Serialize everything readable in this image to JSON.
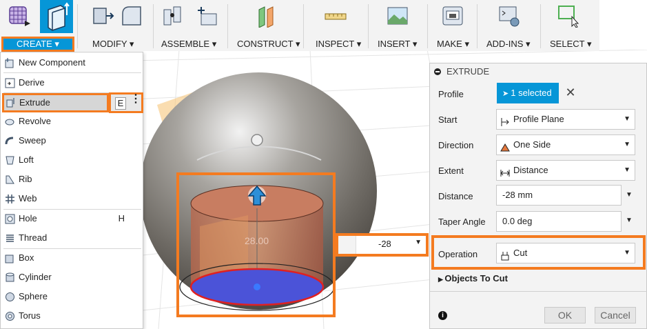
{
  "toolbar": {
    "groups": [
      {
        "label": "CREATE ▾"
      },
      {
        "label": "MODIFY ▾"
      },
      {
        "label": "ASSEMBLE ▾"
      },
      {
        "label": "CONSTRUCT ▾"
      },
      {
        "label": "INSPECT ▾"
      },
      {
        "label": "INSERT ▾"
      },
      {
        "label": "MAKE ▾"
      },
      {
        "label": "ADD-INS ▾"
      },
      {
        "label": "SELECT ▾"
      }
    ]
  },
  "create_menu": {
    "items": [
      {
        "label": "New Component",
        "icon": "new-component-icon"
      },
      {
        "label": "Derive",
        "icon": "derive-icon"
      },
      {
        "label": "Extrude",
        "icon": "extrude-icon",
        "shortcut": "E"
      },
      {
        "label": "Revolve",
        "icon": "revolve-icon"
      },
      {
        "label": "Sweep",
        "icon": "sweep-icon"
      },
      {
        "label": "Loft",
        "icon": "loft-icon"
      },
      {
        "label": "Rib",
        "icon": "rib-icon"
      },
      {
        "label": "Web",
        "icon": "web-icon"
      },
      {
        "label": "Hole",
        "icon": "hole-icon",
        "shortcut": "H"
      },
      {
        "label": "Thread",
        "icon": "thread-icon"
      },
      {
        "label": "Box",
        "icon": "box-icon"
      },
      {
        "label": "Cylinder",
        "icon": "cylinder-icon"
      },
      {
        "label": "Sphere",
        "icon": "sphere-icon"
      },
      {
        "label": "Torus",
        "icon": "torus-icon"
      }
    ]
  },
  "viewport": {
    "dimension_label": "28.00",
    "distance_input_value": "-28"
  },
  "extrude_panel": {
    "title": "EXTRUDE",
    "rows": {
      "profile": {
        "label": "Profile",
        "value": "1 selected"
      },
      "start": {
        "label": "Start",
        "value": "Profile Plane"
      },
      "direction": {
        "label": "Direction",
        "value": "One Side"
      },
      "extent": {
        "label": "Extent",
        "value": "Distance"
      },
      "distance": {
        "label": "Distance",
        "value": "-28 mm"
      },
      "taper": {
        "label": "Taper Angle",
        "value": "0.0 deg"
      },
      "operation": {
        "label": "Operation",
        "value": "Cut"
      }
    },
    "objects_to_cut": "Objects To Cut",
    "ok_label": "OK",
    "cancel_label": "Cancel"
  },
  "colors": {
    "accent_blue": "#0696d7",
    "highlight_orange": "#f47b20"
  }
}
